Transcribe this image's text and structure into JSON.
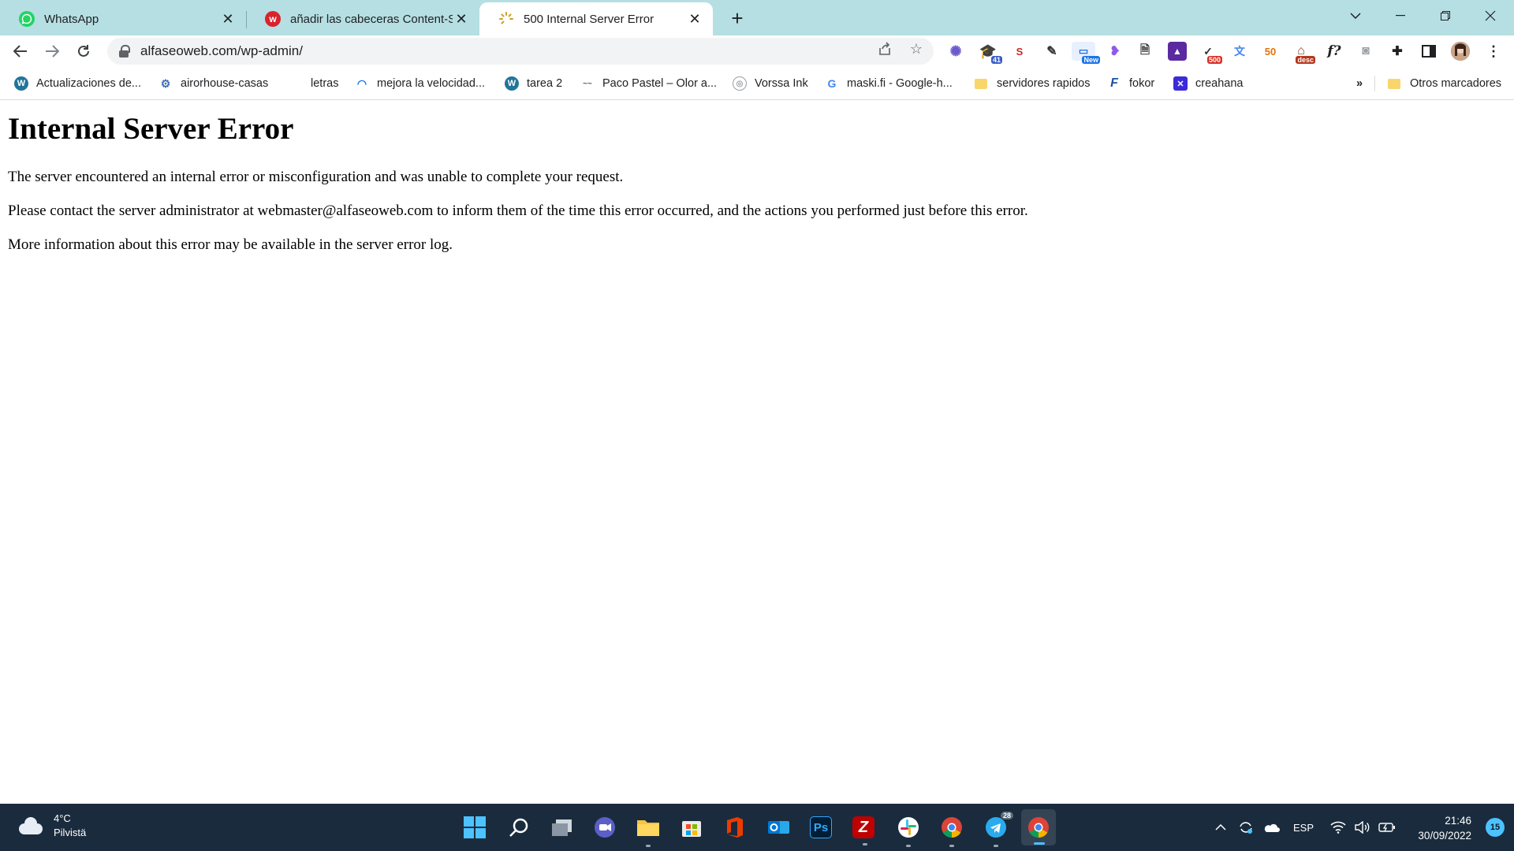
{
  "browser": {
    "tabs": [
      {
        "title": "WhatsApp",
        "favicon": "whatsapp-icon",
        "active": false
      },
      {
        "title": "añadir las cabeceras Content-Sec",
        "favicon": "w-logo-icon",
        "active": false
      },
      {
        "title": "500 Internal Server Error",
        "favicon": "loading-spinner-icon",
        "active": true
      }
    ],
    "new_tab_label": "+",
    "url": "alfaseoweb.com/wp-admin/",
    "extensions": [
      {
        "name": "puzzle-sparkle-icon"
      },
      {
        "name": "graduation-cap-icon",
        "badge": "41"
      },
      {
        "name": "seo-icon",
        "label": "S"
      },
      {
        "name": "pen-icon"
      },
      {
        "name": "new-extension-icon",
        "badge": "New"
      },
      {
        "name": "heart-icon"
      },
      {
        "name": "image-icon"
      },
      {
        "name": "photo-icon"
      },
      {
        "name": "http-status-icon",
        "badge": "500"
      },
      {
        "name": "translate-icon"
      },
      {
        "name": "fifty-icon",
        "label": "50"
      },
      {
        "name": "desc-icon",
        "badge": "desc"
      },
      {
        "name": "formula-icon",
        "label": "f?"
      },
      {
        "name": "camera-icon"
      },
      {
        "name": "extensions-puzzle-icon"
      },
      {
        "name": "sidepanel-icon"
      },
      {
        "name": "profile-avatar"
      },
      {
        "name": "menu-icon"
      }
    ]
  },
  "bookmarks": {
    "items": [
      {
        "label": "Actualizaciones de...",
        "icon": "wordpress-icon"
      },
      {
        "label": "airorhouse-casas",
        "icon": "gear-doc-icon"
      },
      {
        "label": "letras",
        "icon": "blank-icon"
      },
      {
        "label": "mejora la velocidad...",
        "icon": "speed-icon"
      },
      {
        "label": "tarea 2",
        "icon": "wordpress-icon"
      },
      {
        "label": "Paco Pastel – Olor a...",
        "icon": "paco-icon"
      },
      {
        "label": "Vorssa Ink",
        "icon": "globe-icon"
      },
      {
        "label": "maski.fi - Google-h...",
        "icon": "google-icon"
      },
      {
        "label": "servidores rapidos",
        "icon": "folder-icon"
      },
      {
        "label": "fokor",
        "icon": "fokor-icon"
      },
      {
        "label": "creahana",
        "icon": "crehana-icon"
      }
    ],
    "overflow_label": "»",
    "other_label": "Otros marcadores"
  },
  "page": {
    "heading": "Internal Server Error",
    "paragraphs": [
      "The server encountered an internal error or misconfiguration and was unable to complete your request.",
      "Please contact the server administrator at webmaster@alfaseoweb.com to inform them of the time this error occurred, and the actions you performed just before this error.",
      "More information about this error may be available in the server error log."
    ]
  },
  "taskbar": {
    "weather": {
      "temp": "4°C",
      "condition": "Pilvistä"
    },
    "apps": [
      {
        "name": "windows-start-icon"
      },
      {
        "name": "search-icon"
      },
      {
        "name": "task-view-icon"
      },
      {
        "name": "teams-chat-icon"
      },
      {
        "name": "file-explorer-icon"
      },
      {
        "name": "microsoft-store-icon"
      },
      {
        "name": "office-icon"
      },
      {
        "name": "outlook-icon"
      },
      {
        "name": "photoshop-icon",
        "label": "Ps"
      },
      {
        "name": "filezilla-icon",
        "label": "Z"
      },
      {
        "name": "slack-icon"
      },
      {
        "name": "chrome-icon"
      },
      {
        "name": "telegram-icon",
        "badge": "28"
      },
      {
        "name": "chrome-profile-icon"
      }
    ],
    "tray": {
      "language": "ESP",
      "time": "21:46",
      "date": "30/09/2022",
      "notifications": "15"
    }
  },
  "colors": {
    "tabstrip_bg": "#b5dfe3",
    "taskbar_bg": "#1a2b3d",
    "accent": "#4cc2ff"
  }
}
